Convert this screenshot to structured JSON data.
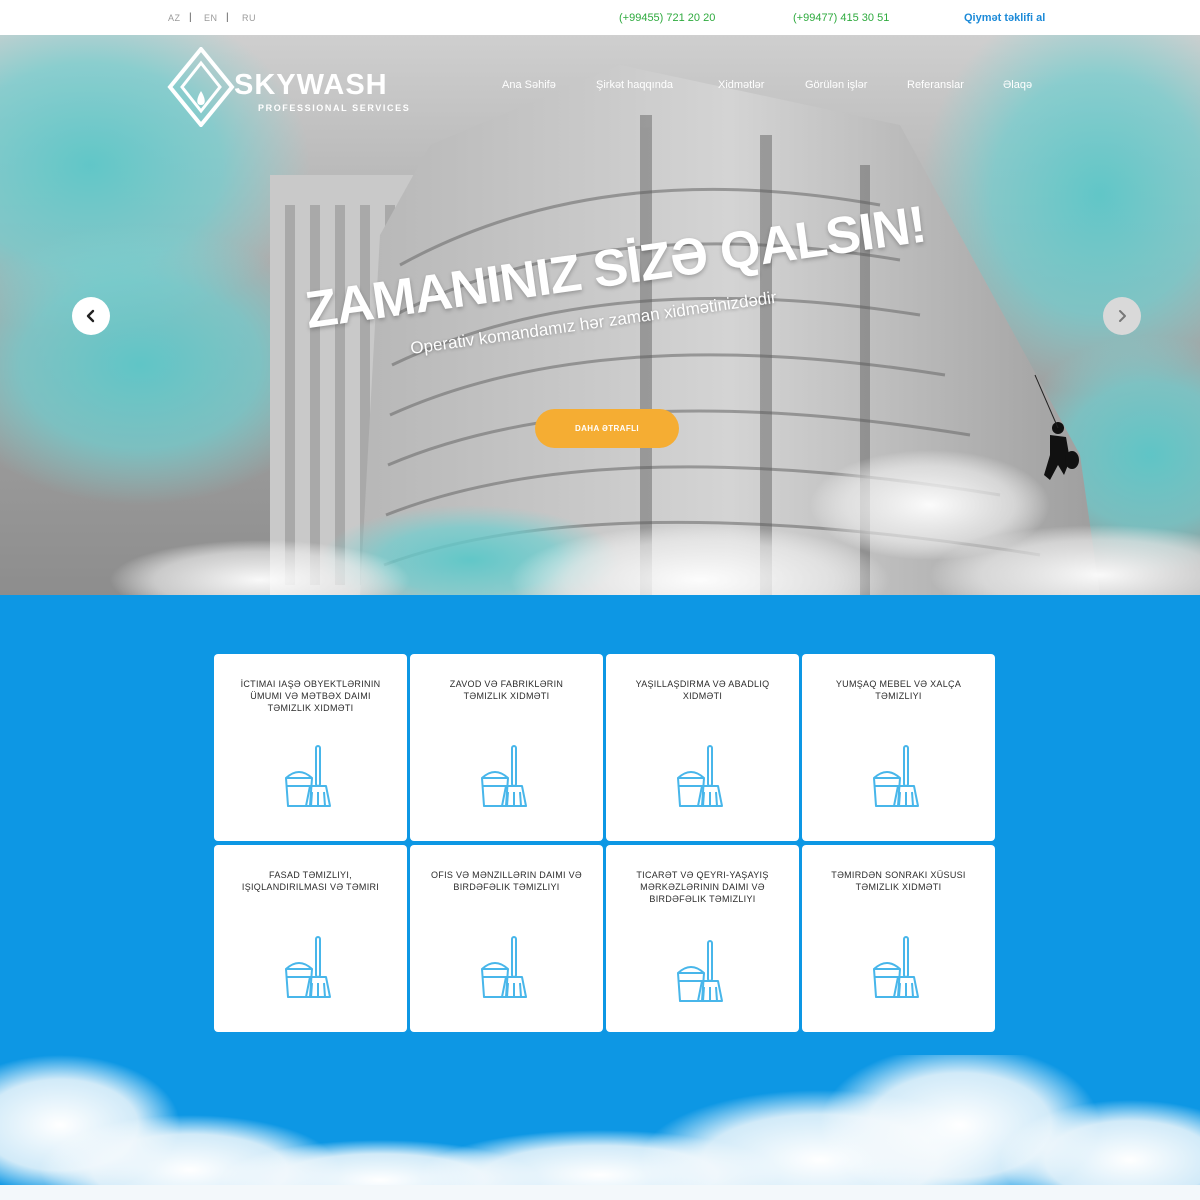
{
  "topbar": {
    "languages": [
      "AZ",
      "EN",
      "RU"
    ],
    "phones": [
      "(+99455) 721 20 20",
      "(+99477) 415 30 51"
    ],
    "quote_link": "Qiymət təklifi al"
  },
  "brand": {
    "name": "SKYWASH",
    "tagline": "PROFESSIONAL SERVICES"
  },
  "nav": {
    "items": [
      "Ana Səhifə",
      "Şirkət haqqında",
      "Xidmətlər",
      "Görülən işlər",
      "Referanslar",
      "Əlaqə"
    ]
  },
  "hero": {
    "headline": "ZAMANINIZ SİZƏ QALSIN!",
    "subline": "Operativ komandamız hər zaman xidmətinizdədir",
    "cta_label": "DAHA ƏTRAFLI"
  },
  "services": [
    {
      "title": "İctimai iaşə obyektlərinin ümumi və mətbəx daimi təmizlik xidməti",
      "icon": "bucket-mop-icon"
    },
    {
      "title": "Zavod və fabriklərin təmizlik xidməti",
      "icon": "bucket-mop-icon"
    },
    {
      "title": "Yaşıllaşdırma və abadlıq xidməti",
      "icon": "bucket-mop-icon"
    },
    {
      "title": "Yumşaq mebel və xalça təmizliyi",
      "icon": "bucket-mop-icon"
    },
    {
      "title": "Fasad təmizliyi, işıqlandırılması və təmiri",
      "icon": "bucket-mop-icon"
    },
    {
      "title": "Ofis və mənzillərin daimi və birdəfəlik təmizliyi",
      "icon": "bucket-mop-icon"
    },
    {
      "title": "Ticarət və qeyri-yaşayış mərkəzlərinin daimi və birdəfəlik təmizliyi",
      "icon": "bucket-mop-icon"
    },
    {
      "title": "Təmirdən sonraki xüsusi təmizlik xidməti",
      "icon": "bucket-mop-icon"
    }
  ],
  "colors": {
    "accent_blue": "#0d97e4",
    "cta_orange": "#f5ad33",
    "phone_green": "#2eaa3e",
    "link_blue": "#1c8ad8",
    "icon_blue": "#48b6ea"
  }
}
